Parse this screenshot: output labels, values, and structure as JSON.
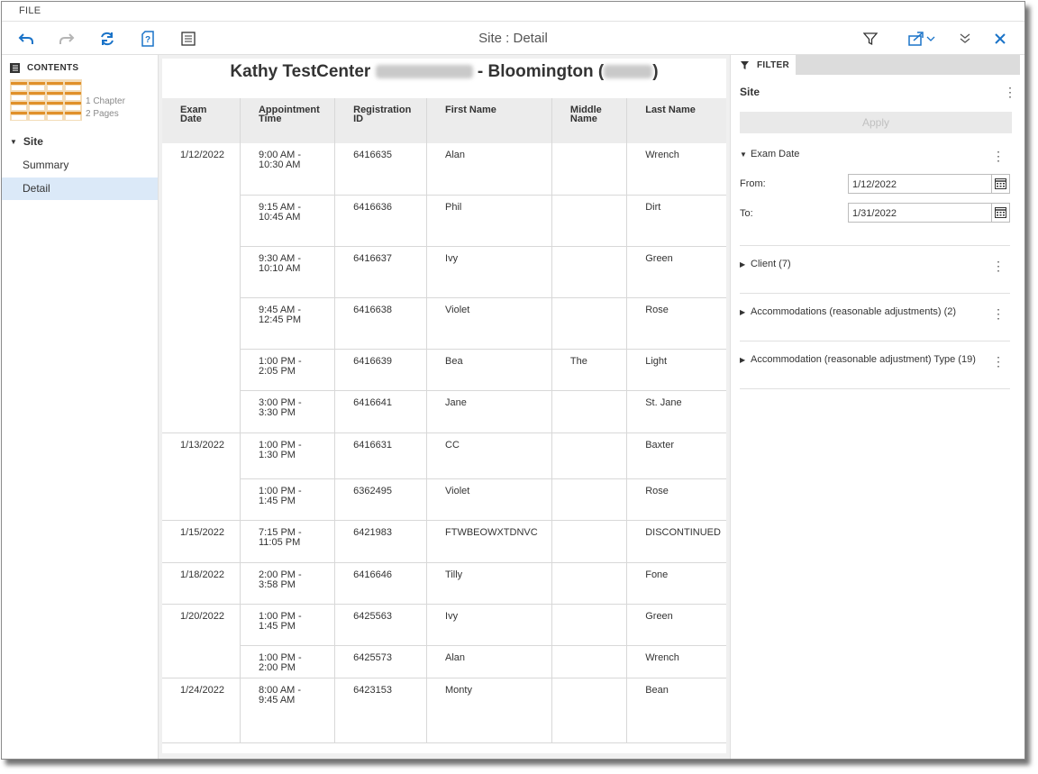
{
  "menu": {
    "file_label": "FILE"
  },
  "toolbar": {
    "title": "Site : Detail"
  },
  "contents": {
    "header": "CONTENTS",
    "thumb_info_chapters": "1 Chapter",
    "thumb_info_pages": "2 Pages",
    "site_label": "Site",
    "items": [
      {
        "label": "Summary",
        "active": false
      },
      {
        "label": "Detail",
        "active": true
      }
    ]
  },
  "report": {
    "title_prefix": "Kathy TestCenter",
    "title_middle": "- Bloomington (",
    "title_suffix": ")",
    "columns": [
      "Exam Date",
      "Appointment Time",
      "Registration ID",
      "First Name",
      "Middle Name",
      "Last Name"
    ],
    "groups": [
      {
        "date": "1/12/2022",
        "rows": [
          {
            "time": "9:00 AM - 10:30 AM",
            "reg": "6416635",
            "first": "Alan",
            "middle": "",
            "last": "Wrench"
          },
          {
            "time": "9:15 AM - 10:45 AM",
            "reg": "6416636",
            "first": "Phil",
            "middle": "",
            "last": "Dirt"
          },
          {
            "time": "9:30 AM - 10:10 AM",
            "reg": "6416637",
            "first": "Ivy",
            "middle": "",
            "last": "Green"
          },
          {
            "time": "9:45 AM - 12:45 PM",
            "reg": "6416638",
            "first": "Violet",
            "middle": "",
            "last": "Rose"
          },
          {
            "time": "1:00 PM - 2:05 PM",
            "reg": "6416639",
            "first": "Bea",
            "middle": "The",
            "last": "Light"
          },
          {
            "time": "3:00 PM - 3:30 PM",
            "reg": "6416641",
            "first": "Jane",
            "middle": "",
            "last": "St. Jane"
          }
        ]
      },
      {
        "date": "1/13/2022",
        "rows": [
          {
            "time": "1:00 PM - 1:30 PM",
            "reg": "6416631",
            "first": "CC",
            "middle": "",
            "last": "Baxter"
          },
          {
            "time": "1:00 PM - 1:45 PM",
            "reg": "6362495",
            "first": "Violet",
            "middle": "",
            "last": "Rose"
          }
        ]
      },
      {
        "date": "1/15/2022",
        "rows": [
          {
            "time": "7:15 PM - 11:05 PM",
            "reg": "6421983",
            "first": "FTWBEOWXTDNVC",
            "middle": "",
            "last": "DISCONTINUED"
          }
        ]
      },
      {
        "date": "1/18/2022",
        "rows": [
          {
            "time": "2:00 PM - 3:58 PM",
            "reg": "6416646",
            "first": "Tilly",
            "middle": "",
            "last": "Fone"
          }
        ]
      },
      {
        "date": "1/20/2022",
        "rows": [
          {
            "time": "1:00 PM - 1:45 PM",
            "reg": "6425563",
            "first": "Ivy",
            "middle": "",
            "last": "Green"
          },
          {
            "time": "1:00 PM - 2:00 PM",
            "reg": "6425573",
            "first": "Alan",
            "middle": "",
            "last": "Wrench"
          }
        ]
      },
      {
        "date": "1/24/2022",
        "rows": [
          {
            "time": "8:00 AM - 9:45 AM",
            "reg": "6423153",
            "first": "Monty",
            "middle": "",
            "last": "Bean"
          }
        ]
      }
    ]
  },
  "filter": {
    "tab_label": "FILTER",
    "site_label": "Site",
    "apply_label": "Apply",
    "exam_date_label": "Exam Date",
    "from_label": "From:",
    "from_value": "1/12/2022",
    "to_label": "To:",
    "to_value": "1/31/2022",
    "sections": [
      "Client (7)",
      "Accommodations (reasonable adjustments) (2)",
      "Accommodation (reasonable adjustment) Type (19)"
    ]
  },
  "colors": {
    "accent": "#1a73c8",
    "active_nav": "#dbe9f8",
    "header_bg": "#ececec"
  },
  "icons": [
    "undo-icon",
    "redo-icon",
    "refresh-icon",
    "help-doc-icon",
    "list-icon",
    "filter-icon",
    "export-icon",
    "chevron-down-icon",
    "collapse-icon",
    "close-icon",
    "contents-icon",
    "calendar-icon"
  ]
}
